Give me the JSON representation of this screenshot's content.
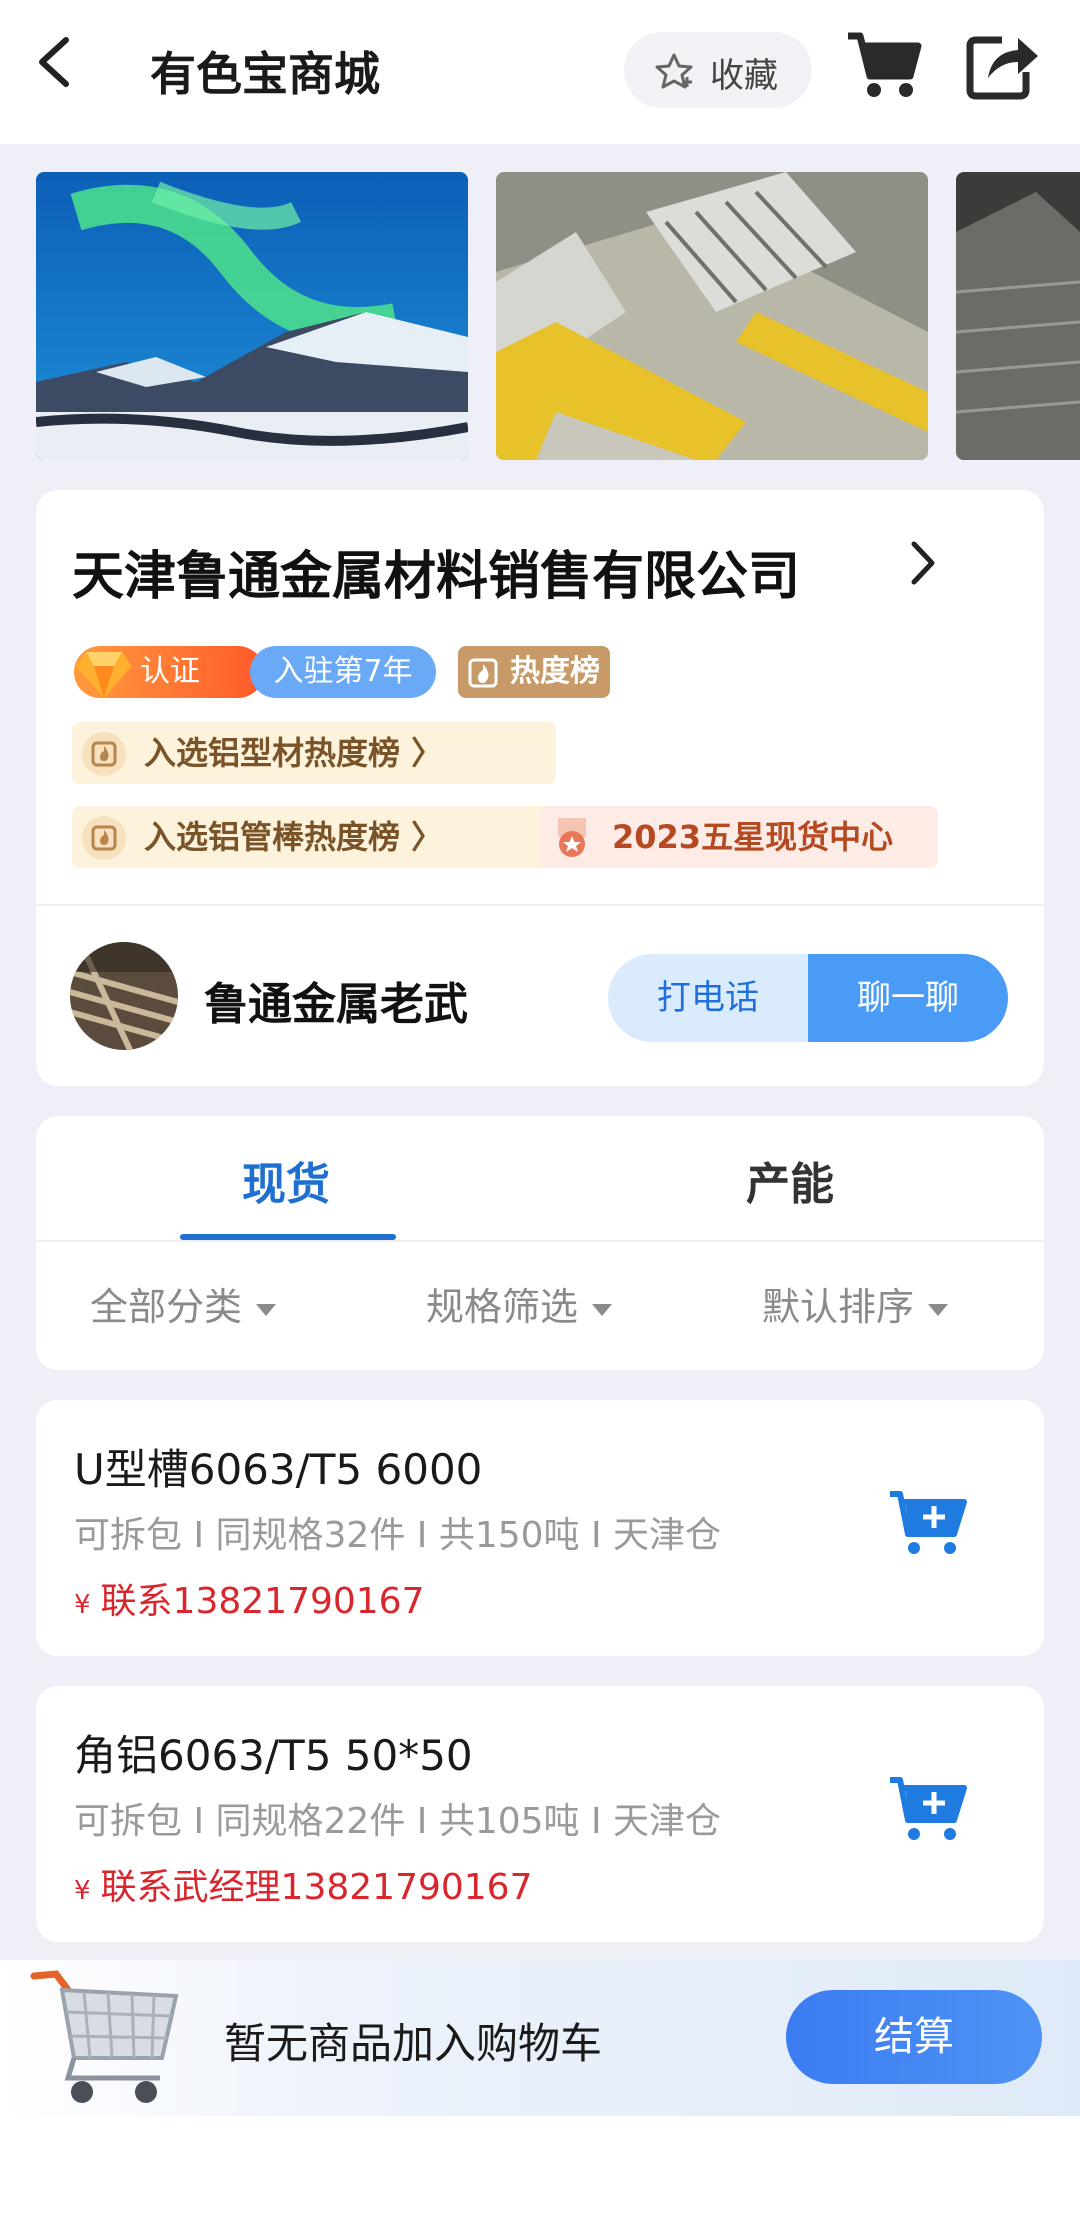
{
  "header": {
    "title": "有色宝商城",
    "favorite_label": "收藏"
  },
  "store": {
    "name": "天津鲁通金属材料销售有限公司",
    "badges": {
      "certified": "认证",
      "years": "入驻第7年",
      "hot": "热度榜"
    },
    "rankings": [
      "入选铝型材热度榜 〉",
      "入选铝管棒热度榜 〉",
      "2023五星现货中心"
    ],
    "seller_name": "鲁通金属老武",
    "call_label": "打电话",
    "chat_label": "聊一聊"
  },
  "tabs": {
    "items": [
      "现货",
      "产能"
    ],
    "active": "现货"
  },
  "filters": [
    "全部分类",
    "规格筛选",
    "默认排序"
  ],
  "products": [
    {
      "name": "U型槽6063/T5 6000",
      "meta": "可拆包 I 同规格32件 I 共150吨 I 天津仓",
      "contact": "联系13821790167",
      "currency": "¥"
    },
    {
      "name": "角铝6063/T5 50*50",
      "meta": "可拆包 I 同规格22件 I 共105吨 I 天津仓",
      "contact": "联系武经理13821790167",
      "currency": "¥"
    }
  ],
  "bottom_bar": {
    "empty_text": "暂无商品加入购物车",
    "checkout_label": "结算"
  },
  "colors": {
    "accent": "#1f6fd0",
    "price_red": "#d9262c",
    "chat_blue": "#4a9bf6"
  }
}
